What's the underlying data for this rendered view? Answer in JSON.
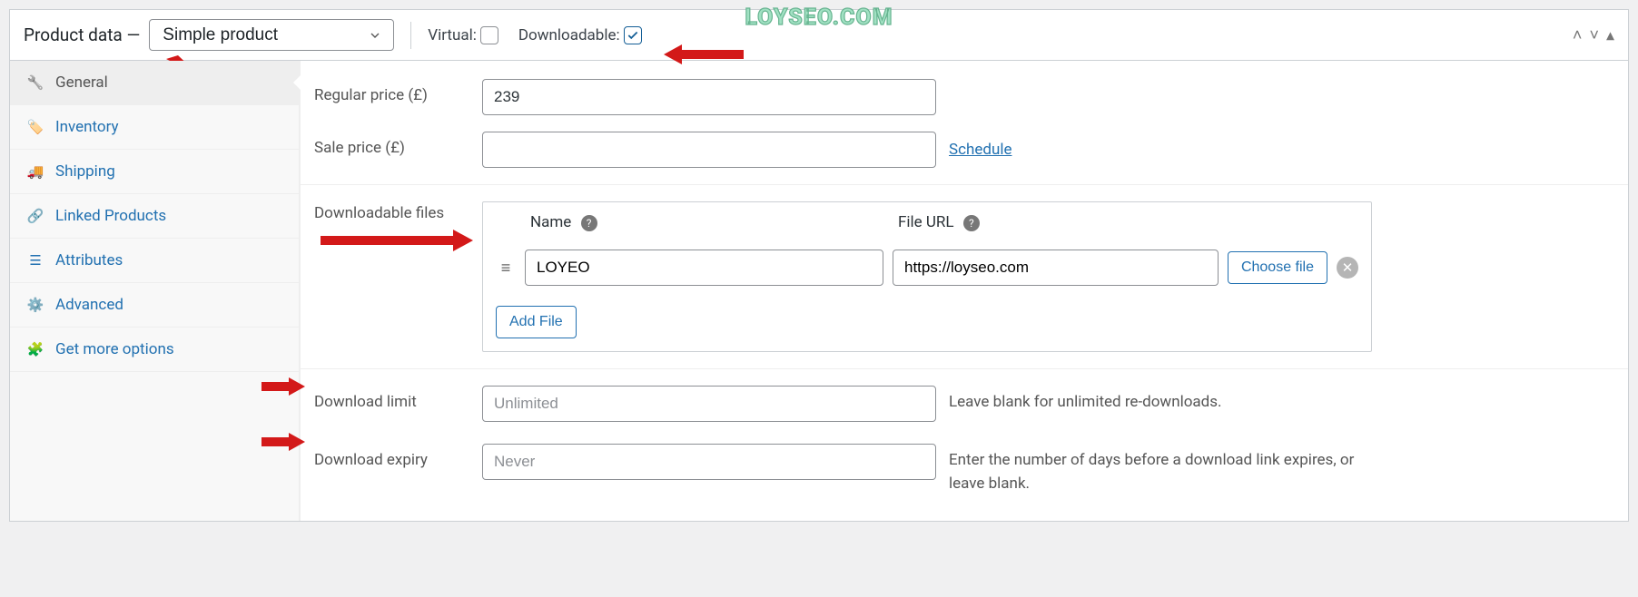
{
  "watermark": "LOYSEO.COM",
  "panel_title": "Product data —",
  "product_type": "Simple product",
  "virtual": {
    "label": "Virtual:",
    "checked": false
  },
  "downloadable": {
    "label": "Downloadable:",
    "checked": true
  },
  "tabs": {
    "general": "General",
    "inventory": "Inventory",
    "shipping": "Shipping",
    "linked": "Linked Products",
    "attributes": "Attributes",
    "advanced": "Advanced",
    "getmore": "Get more options"
  },
  "fields": {
    "regular_price": {
      "label": "Regular price (£)",
      "value": "239"
    },
    "sale_price": {
      "label": "Sale price (£)",
      "value": "",
      "schedule": "Schedule"
    },
    "download_files": {
      "label": "Downloadable files",
      "name_header": "Name",
      "url_header": "File URL",
      "add_button": "Add File",
      "choose_button": "Choose file",
      "rows": [
        {
          "name": "LOYEO",
          "url": "https://loyseo.com"
        }
      ]
    },
    "download_limit": {
      "label": "Download limit",
      "placeholder": "Unlimited",
      "hint": "Leave blank for unlimited re-downloads."
    },
    "download_expiry": {
      "label": "Download expiry",
      "placeholder": "Never",
      "hint": "Enter the number of days before a download link expires, or leave blank."
    }
  }
}
